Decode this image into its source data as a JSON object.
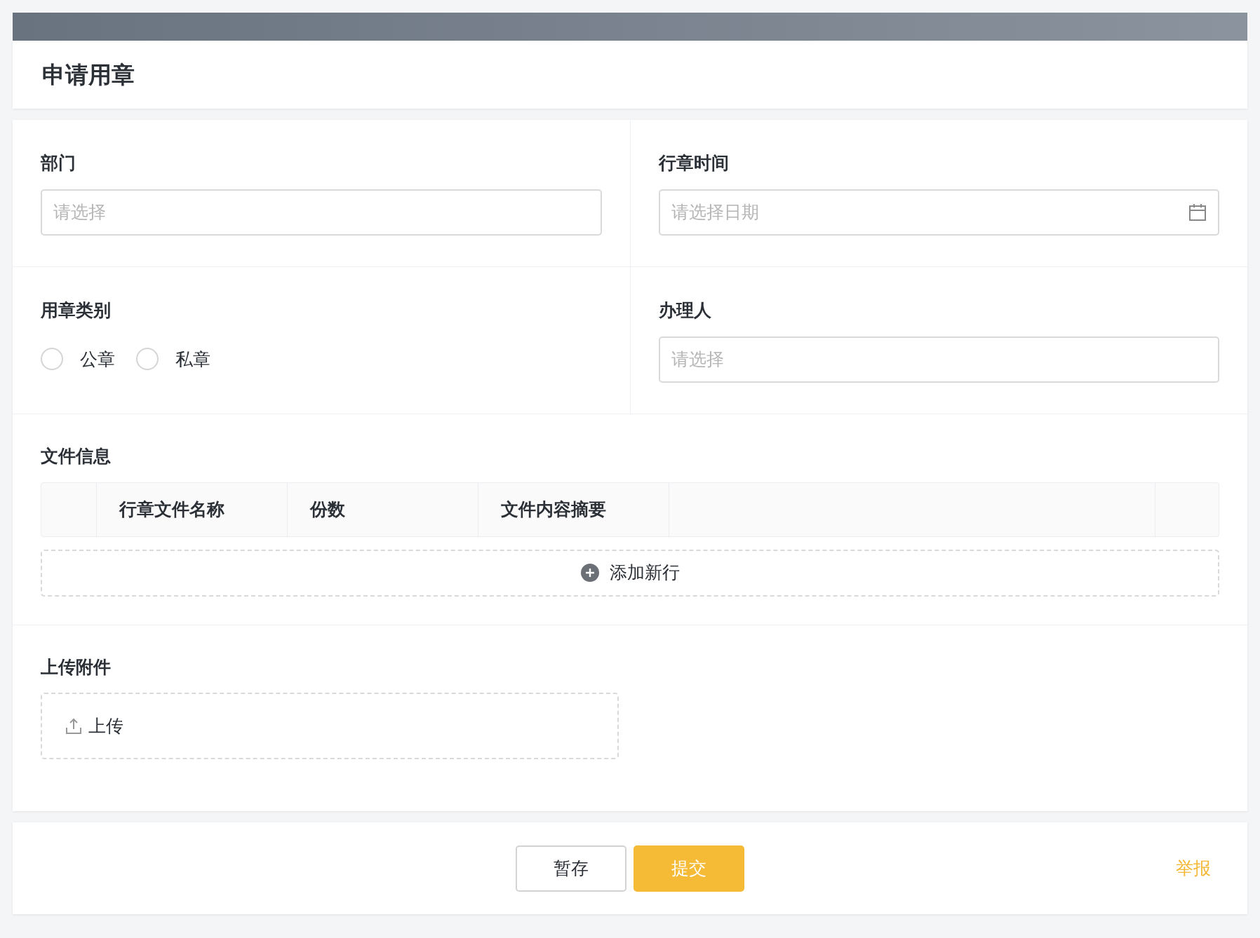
{
  "title": "申请用章",
  "fields": [
    {
      "kind": "select",
      "label": "部门",
      "placeholder": "请选择"
    },
    {
      "kind": "date",
      "label": "行章时间",
      "placeholder": "请选择日期"
    },
    {
      "kind": "radio",
      "label": "用章类别",
      "options": [
        {
          "label": "公章",
          "selected": false
        },
        {
          "label": "私章",
          "selected": false
        }
      ]
    },
    {
      "kind": "select",
      "label": "办理人",
      "placeholder": "请选择"
    }
  ],
  "file_info": {
    "label": "文件信息",
    "columns": [
      "行章文件名称",
      "份数",
      "文件内容摘要"
    ],
    "add_row": "添加新行"
  },
  "attachments": {
    "label": "上传附件",
    "upload_button": "上传"
  },
  "footer": {
    "buttons": [
      {
        "label": "暂存",
        "kind": "secondary"
      },
      {
        "label": "提交",
        "kind": "primary"
      }
    ],
    "report_link": "举报"
  }
}
